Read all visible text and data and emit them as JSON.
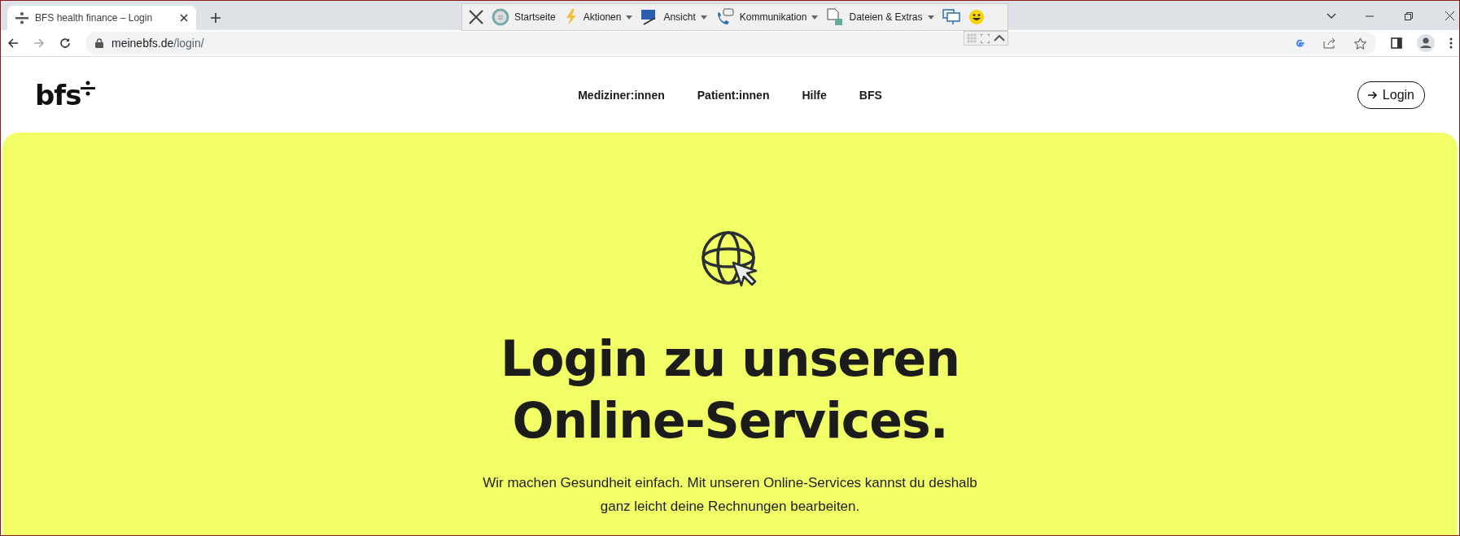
{
  "browser": {
    "tab_title": "BFS health finance – Login",
    "url_host": "meinebfs.de",
    "url_path": "/login/"
  },
  "remote_toolbar": {
    "items": [
      {
        "label": "Startseite",
        "dropdown": false,
        "kind": "home"
      },
      {
        "label": "Aktionen",
        "dropdown": true,
        "kind": "bolt"
      },
      {
        "label": "Ansicht",
        "dropdown": true,
        "kind": "monitor"
      },
      {
        "label": "Kommunikation",
        "dropdown": true,
        "kind": "phone"
      },
      {
        "label": "Dateien & Extras",
        "dropdown": true,
        "kind": "file"
      }
    ]
  },
  "header": {
    "logo": "bfs",
    "nav": [
      "Mediziner:innen",
      "Patient:innen",
      "Hilfe",
      "BFS"
    ],
    "login_button": "Login"
  },
  "hero": {
    "title_lines": [
      "Login zu unseren",
      "Online-Services."
    ],
    "text_lines": [
      "Wir machen Gesundheit einfach. Mit unseren Online-Services kannst du deshalb",
      "ganz leicht deine Rechnungen bearbeiten."
    ]
  }
}
